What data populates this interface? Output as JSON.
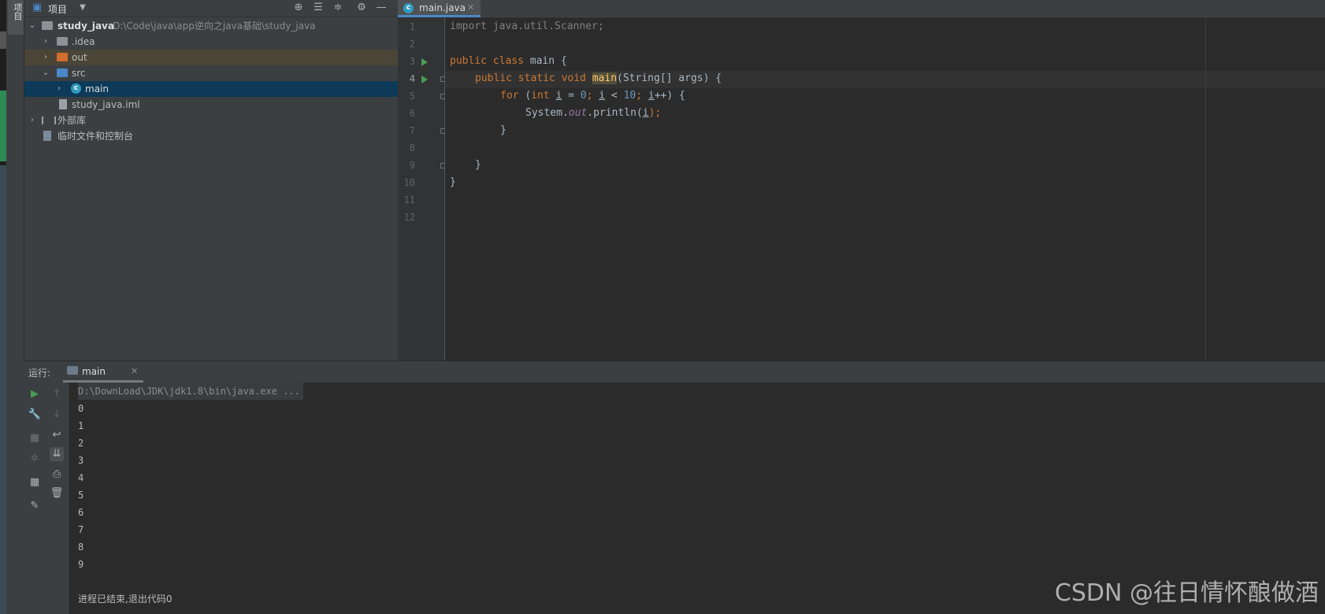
{
  "sidebar_strip": {
    "tool_tab_label": "项目"
  },
  "project_panel": {
    "title": "项目",
    "header_icons": [
      "locate-icon",
      "expand-all-icon",
      "collapse-all-icon",
      "gear-icon",
      "minimize-icon"
    ],
    "tree": [
      {
        "name": "study_java",
        "path": "D:\\Code\\java\\app逆向之java基础\\study_java"
      },
      {
        "name": ".idea"
      },
      {
        "name": "out"
      },
      {
        "name": "src"
      },
      {
        "name": "main"
      },
      {
        "name": "study_java.iml"
      },
      {
        "name": "外部库"
      },
      {
        "name": "临时文件和控制台"
      }
    ]
  },
  "editor": {
    "tab": {
      "label": "main.java"
    },
    "line_numbers": [
      "1",
      "2",
      "3",
      "4",
      "5",
      "6",
      "7",
      "8",
      "9",
      "10",
      "11",
      "12"
    ],
    "code": {
      "l1": "import java.util.Scanner;",
      "l3_kw": "public class ",
      "l3_rest": "main {",
      "l4_kw": "public static void ",
      "l4_method": "main",
      "l4_rest": "(String[] args) {",
      "l5_kw1": "for ",
      "l5_p1": "(",
      "l5_kw2": "int ",
      "l5_i1": "i",
      "l5_p2": " = ",
      "l5_n1": "0",
      "l5_p3": "; ",
      "l5_i2": "i",
      "l5_p4": " < ",
      "l5_n2": "10",
      "l5_p5": "; ",
      "l5_i3": "i",
      "l5_p6": "++) {",
      "l6_a": "System.",
      "l6_field": "out",
      "l6_b": ".println(",
      "l6_i": "i",
      "l6_c": ");",
      "l7": "}",
      "l9": "}",
      "l10": "}"
    }
  },
  "run_panel": {
    "label": "运行:",
    "tab": {
      "label": "main"
    },
    "command": "D:\\DownLoad\\JDK\\jdk1.8\\bin\\java.exe ...",
    "output": [
      "0",
      "1",
      "2",
      "3",
      "4",
      "5",
      "6",
      "7",
      "8",
      "9"
    ],
    "exit_message": "进程已结束,退出代码0"
  },
  "watermark": "CSDN @往日情怀酿做酒"
}
